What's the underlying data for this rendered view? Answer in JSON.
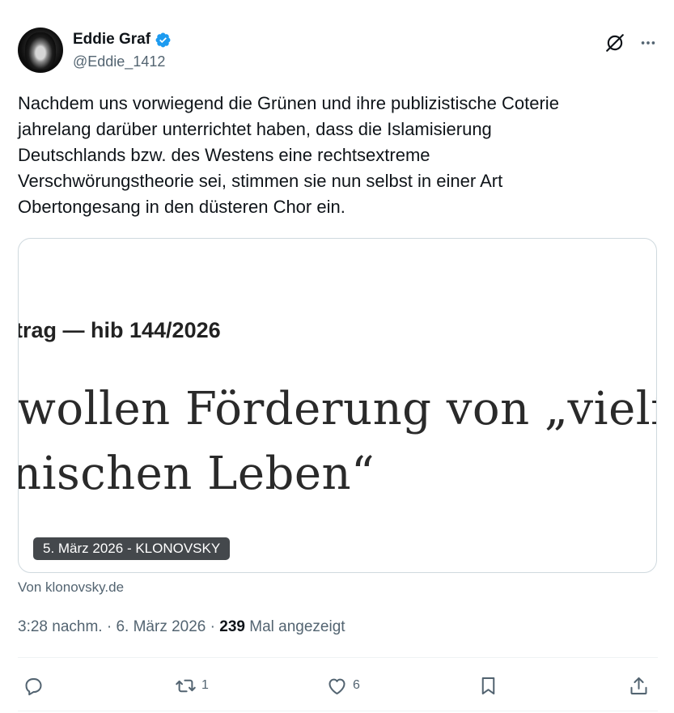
{
  "author": {
    "display_name": "Eddie Graf",
    "handle": "@Eddie_1412",
    "verified": true,
    "verified_color": "#1d9bf0"
  },
  "header_icons": [
    "grok-icon",
    "more-icon"
  ],
  "tweet": {
    "text": "Nachdem uns vorwiegend die Grünen und ihre publizistische Coterie\njahrelang darüber unterrichtet haben, dass die Islamisierung\nDeutschlands bzw. des Westens eine rechtsextreme\nVerschwörungstheorie sei, stimmen sie nun selbst in einer Art\nObertongesang in den düsteren Chor ein."
  },
  "card": {
    "line1": "trag — hib 144/2026",
    "line2": "wollen Förderung von „vielfä",
    "line3": "nischen Leben“",
    "badge": "5. März 2026 - KLONOVSKY",
    "source": "Von klonovsky.de"
  },
  "meta": {
    "time": "3:28 nachm.",
    "separator1": "·",
    "date": "6. März 2026",
    "separator2": "·",
    "views_count": "239",
    "views_label": "Mal angezeigt"
  },
  "actions": {
    "reply_count": "",
    "repost_count": "1",
    "like_count": "6"
  },
  "colors": {
    "text_primary": "#0f1419",
    "text_secondary": "#536471",
    "border": "#cfd9de"
  }
}
